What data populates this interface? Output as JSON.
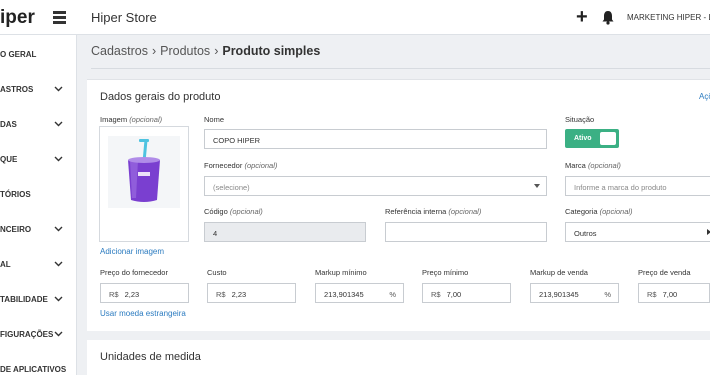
{
  "header": {
    "logo": "iper",
    "store": "Hiper Store",
    "user": "MARKETING HIPER - LOJA"
  },
  "sidebar": {
    "items": [
      {
        "label": "O GERAL",
        "has_chevron": false
      },
      {
        "label": "ASTROS",
        "has_chevron": true
      },
      {
        "label": "DAS",
        "has_chevron": true
      },
      {
        "label": "QUE",
        "has_chevron": true
      },
      {
        "label": "TÓRIOS",
        "has_chevron": false
      },
      {
        "label": "NCEIRO",
        "has_chevron": true
      },
      {
        "label": "AL",
        "has_chevron": true
      },
      {
        "label": "TABILIDADE",
        "has_chevron": true
      },
      {
        "label": "FIGURAÇÕES",
        "has_chevron": true
      },
      {
        "label": "DE APLICATIVOS",
        "has_chevron": false
      }
    ]
  },
  "breadcrumb": {
    "items": [
      "Cadastros",
      "Produtos"
    ],
    "current": "Produto simples"
  },
  "panel": {
    "title": "Dados gerais do produto",
    "actions": "Açõ",
    "image_label": "Imagem",
    "image_hint": "(opcional)",
    "add_image": "Adicionar imagem",
    "nome": {
      "label": "Nome",
      "value": "COPO HIPER"
    },
    "situacao": {
      "label": "Situação",
      "value": "Ativo"
    },
    "fornecedor": {
      "label": "Fornecedor",
      "hint": "(opcional)",
      "value": "(selecione)"
    },
    "marca": {
      "label": "Marca",
      "hint": "(opcional)",
      "placeholder": "Informe a marca do produto"
    },
    "codigo": {
      "label": "Código",
      "hint": "(opcional)",
      "value": "4"
    },
    "referencia": {
      "label": "Referência interna",
      "hint": "(opcional)",
      "value": ""
    },
    "categoria": {
      "label": "Categoria",
      "hint": "(opcional)",
      "value": "Outros"
    },
    "pricing": [
      {
        "label": "Preço do fornecedor",
        "prefix": "R$",
        "value": "2,23"
      },
      {
        "label": "Custo",
        "prefix": "R$",
        "value": "2,23"
      },
      {
        "label": "Markup mínimo",
        "value": "213,901345",
        "suffix": "%"
      },
      {
        "label": "Preço mínimo",
        "prefix": "R$",
        "value": "7,00"
      },
      {
        "label": "Markup de venda",
        "value": "213,901345",
        "suffix": "%"
      },
      {
        "label": "Preço de venda",
        "prefix": "R$",
        "value": "7,00"
      }
    ],
    "foreign_currency": "Usar moeda estrangeira"
  },
  "panel2": {
    "title": "Unidades de medida"
  },
  "colors": {
    "accent": "#2b7bc0",
    "toggle_active": "#3bb084",
    "cup_purple": "#7a3fd0",
    "straw": "#4ec3e0"
  },
  "icons": [
    "hamburger-icon",
    "plus-icon",
    "bell-icon",
    "chevron-down-icon",
    "caret-down-icon",
    "chevron-right-icon"
  ]
}
